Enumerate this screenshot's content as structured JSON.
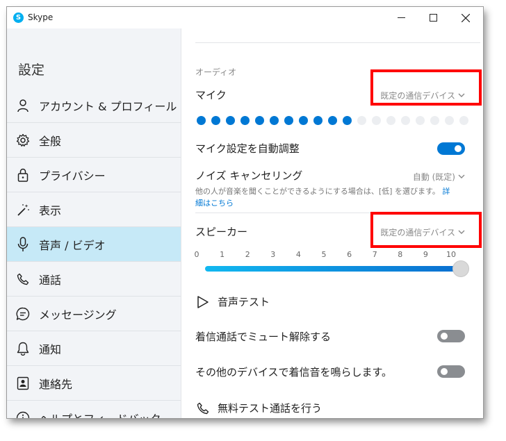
{
  "window": {
    "title": "Skype",
    "app_icon_letter": "S"
  },
  "sidebar": {
    "title": "設定",
    "items": [
      {
        "label": "アカウント & プロフィール",
        "icon": "person-icon"
      },
      {
        "label": "全般",
        "icon": "gear-icon"
      },
      {
        "label": "プライバシー",
        "icon": "lock-icon"
      },
      {
        "label": "表示",
        "icon": "magic-wand-icon"
      },
      {
        "label": "音声 / ビデオ",
        "icon": "microphone-icon",
        "active": true
      },
      {
        "label": "通話",
        "icon": "phone-icon"
      },
      {
        "label": "メッセージング",
        "icon": "chat-icon"
      },
      {
        "label": "通知",
        "icon": "bell-icon"
      },
      {
        "label": "連絡先",
        "icon": "contacts-icon"
      },
      {
        "label": "ヘルプとフィードバック",
        "icon": "info-icon"
      }
    ]
  },
  "audio": {
    "section_label": "オーディオ",
    "mic": {
      "label": "マイク",
      "device": "既定の通信デバイス",
      "level_active_dots": 11,
      "level_total_dots": 19
    },
    "auto_adjust": {
      "label": "マイク設定を自動調整",
      "on": true
    },
    "noise": {
      "label": "ノイズ キャンセリング",
      "value": "自動 (既定)",
      "description": "他の人が音楽を聞くことができるようにする場合は、[低] を選びます。",
      "link": "詳細はこちら"
    },
    "speaker": {
      "label": "スピーカー",
      "device": "既定の通信デバイス",
      "ticks": [
        "0",
        "1",
        "2",
        "3",
        "4",
        "5",
        "6",
        "7",
        "8",
        "9",
        "10"
      ],
      "volume": 10
    },
    "sound_test": {
      "label": "音声テスト"
    },
    "unmute_incoming": {
      "label": "着信通話でミュート解除する",
      "on": false
    },
    "ring_other_devices": {
      "label": "その他のデバイスで着信音を鳴らします。",
      "on": false
    },
    "free_test_call": {
      "label": "無料テスト通話を行う"
    }
  },
  "colors": {
    "accent": "#0078d4",
    "highlight": "#ff0000",
    "active_nav": "#c6e9f7",
    "dot_inactive": "#eceef1"
  }
}
